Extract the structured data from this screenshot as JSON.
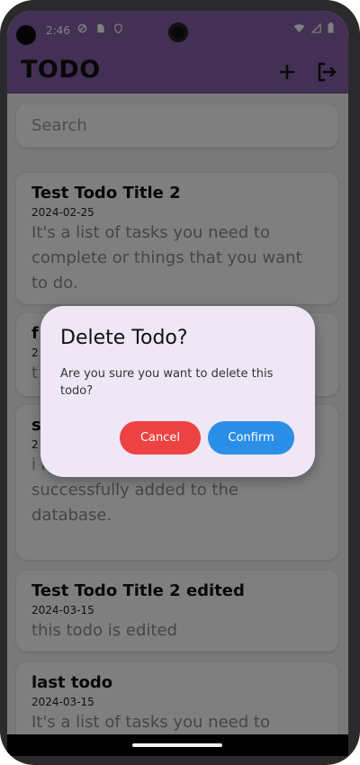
{
  "status_bar": {
    "time": "2:46",
    "left_icons": [
      "privacy-icon",
      "sim-icon",
      "shield-icon"
    ],
    "right_icons": [
      "wifi-icon",
      "signal-icon",
      "battery-icon"
    ]
  },
  "app_bar": {
    "title": "TODO",
    "color": "#8660a8",
    "actions": [
      "add-icon",
      "logout-icon"
    ]
  },
  "search": {
    "placeholder": "Search"
  },
  "todos": [
    {
      "title": "Test Todo Title 2",
      "date": "2024-02-25",
      "body": "It's a list of tasks you need to complete or things that you want to do."
    },
    {
      "title": "f",
      "date": "2",
      "body": "t"
    },
    {
      "title": "s",
      "date": "2",
      "body": "i modal after my todo is successfully added to the database."
    },
    {
      "title": "Test Todo Title 2 edited",
      "date": "2024-03-15",
      "body": "this todo is edited"
    },
    {
      "title": "last todo",
      "date": "2024-03-15",
      "body": "It's a list of tasks you need to"
    }
  ],
  "dialog": {
    "title": "Delete Todo?",
    "message": "Are you sure you want to delete this todo?",
    "cancel_label": "Cancel",
    "confirm_label": "Confirm",
    "cancel_color": "#ec4242",
    "confirm_color": "#2b8fe8"
  }
}
